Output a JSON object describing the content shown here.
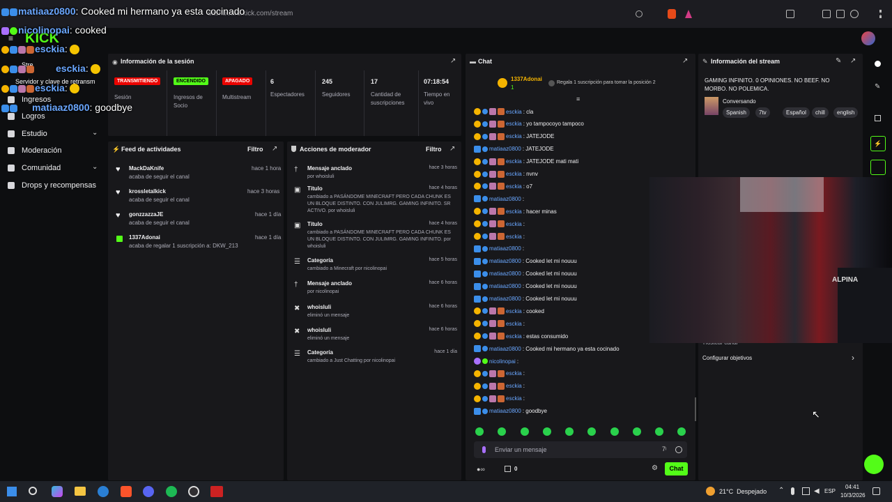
{
  "browser": {
    "url": "dashboard.kick.com/stream"
  },
  "overlay_chat": [
    {
      "user": "matiaaz0800",
      "text": ": Cooked mi hermano ya esta cocinado"
    },
    {
      "user": "nicolinopai",
      "text": ": cooked"
    },
    {
      "user": "esckia",
      "text": ":"
    },
    {
      "user": "esckia",
      "text": ":"
    },
    {
      "user": "esckia",
      "text": ":"
    },
    {
      "user": "matiaaz0800",
      "text": ": goodbye"
    }
  ],
  "overlay_partial": {
    "logo": "KICK",
    "stream_label": "Stre",
    "keys_label": "Servidor y clave de retransm"
  },
  "nav": {
    "items": [
      "Ingresos",
      "Logros",
      "Estudio",
      "Moderación",
      "Comunidad",
      "Drops y recompensas"
    ]
  },
  "session": {
    "title": "Información de la sesión",
    "stats": [
      {
        "badge": "TRANSMITIENDO",
        "label": "Sesión",
        "color": "#eb0400"
      },
      {
        "badge": "ENCENDIDO",
        "label": "Ingresos de Socio",
        "color": "#53fc18"
      },
      {
        "badge": "APAGADO",
        "label": "Multistream",
        "color": "#eb0400"
      },
      {
        "value": "6",
        "label": "Espectadores"
      },
      {
        "value": "245",
        "label": "Seguidores"
      },
      {
        "value": "17",
        "label": "Cantidad de suscripciones"
      },
      {
        "value": "07:18:54",
        "label": "Tiempo en vivo"
      }
    ]
  },
  "activity": {
    "title": "Feed de actividades",
    "filter": "Filtro",
    "items": [
      {
        "name": "MackDaKnife",
        "desc": "acaba de seguir el canal",
        "time": "hace 1 hora"
      },
      {
        "name": "krossletalkick",
        "desc": "acaba de seguir el canal",
        "time": "hace 3 horas"
      },
      {
        "name": "gonzzazzaJE",
        "desc": "acaba de seguir el canal",
        "time": "hace 1 día"
      },
      {
        "name": "1337Adonai",
        "desc": "acaba de regalar 1 suscripción a: DKW_213",
        "time": "hace 1 día"
      }
    ]
  },
  "modactions": {
    "title": "Acciones de moderador",
    "filter": "Filtro",
    "items": [
      {
        "name": "Mensaje anclado",
        "desc": "por whoisluli",
        "time": "hace 3 horas"
      },
      {
        "name": "Título",
        "desc": "cambiado a PASÁNDOME MINECRAFT PERO CADA CHUNK ES UN BLOQUE DISTINTO. CON JULIMRG. GAMING INFINITO. SR ACTIVO. por whoisluli",
        "time": "hace 4 horas"
      },
      {
        "name": "Título",
        "desc": "cambiado a PASÁNDOME MINECRAFT PERO CADA CHUNK ES UN BLOQUE DISTINTO. CON JULIMRG. GAMING INFINITO. por whoisluli",
        "time": "hace 4 horas"
      },
      {
        "name": "Categoría",
        "desc": "cambiado a Minecraft por nicolinopai",
        "time": "hace 5 horas"
      },
      {
        "name": "Mensaje anclado",
        "desc": "por nicolinopai",
        "time": "hace 6 horas"
      },
      {
        "name": "whoisluli",
        "desc": "eliminó un mensaje",
        "time": "hace 6 horas"
      },
      {
        "name": "whoisluli",
        "desc": "eliminó un mensaje",
        "time": "hace 6 horas"
      },
      {
        "name": "Categoría",
        "desc": "cambiado a Just Chatting por nicolinopai",
        "time": "hace 1 día"
      }
    ]
  },
  "chat": {
    "title": "Chat",
    "top_gifter": "1337Adonai",
    "top_count": "1",
    "gift_prompt": "Regala 1 suscripción para tomar la posición 2",
    "messages": [
      {
        "user": "esckia",
        "text": ": cla"
      },
      {
        "user": "esckia",
        "text": ": yo tampocoyo tampoco"
      },
      {
        "user": "esckia",
        "text": ": JATEJODE"
      },
      {
        "user": "matiaaz0800",
        "text": ": JATEJODE"
      },
      {
        "user": "esckia",
        "text": ": JATEJODE mati        mati"
      },
      {
        "user": "esckia",
        "text": ": nvnv"
      },
      {
        "user": "esckia",
        "text": ": o7"
      },
      {
        "user": "matiaaz0800",
        "text": ":"
      },
      {
        "user": "esckia",
        "text": ": hacer minas"
      },
      {
        "user": "esckia",
        "text": ":"
      },
      {
        "user": "esckia",
        "text": ":"
      },
      {
        "user": "matiaaz0800",
        "text": ":"
      },
      {
        "user": "matiaaz0800",
        "text": ": Cooked let mi nouuu"
      },
      {
        "user": "matiaaz0800",
        "text": ": Cooked let mi nouuu"
      },
      {
        "user": "matiaaz0800",
        "text": ": Cooked let mi nouuu"
      },
      {
        "user": "matiaaz0800",
        "text": ": Cooked let mi nouuu"
      },
      {
        "user": "esckia",
        "text": ": cooked"
      },
      {
        "user": "esckia",
        "text": ":"
      },
      {
        "user": "esckia",
        "text": ": estas consumido"
      },
      {
        "user": "matiaaz0800",
        "text": ": Cooked mi hermano ya esta cocinado"
      },
      {
        "user": "nicolinopai",
        "text": ":"
      },
      {
        "user": "esckia",
        "text": ":"
      },
      {
        "user": "esckia",
        "text": ":"
      },
      {
        "user": "esckia",
        "text": ":"
      },
      {
        "user": "matiaaz0800",
        "text": ": goodbye"
      }
    ],
    "input_placeholder": "Enviar un mensaje",
    "points": "0",
    "send_label": "Chat"
  },
  "stream_info": {
    "title": "Información del stream",
    "stream_title": "GAMING INFINITO. 0 OPINIONES. NO BEEF. NO MORBO. NO POLEMICA.",
    "category": "Conversando",
    "tags": [
      "Spanish",
      "7tv",
      "Español",
      "chill",
      "english"
    ],
    "hidden_item": "Hostear canal",
    "goals": "Configurar objetivos"
  },
  "taskbar": {
    "weather": "21°C  Despejado",
    "lang": "ESP",
    "time": "04:41",
    "date": "10/3/2026"
  },
  "colors": {
    "accent": "#53fc18",
    "live": "#eb0400",
    "panel": "#18181b",
    "bg": "#0d0e10"
  }
}
